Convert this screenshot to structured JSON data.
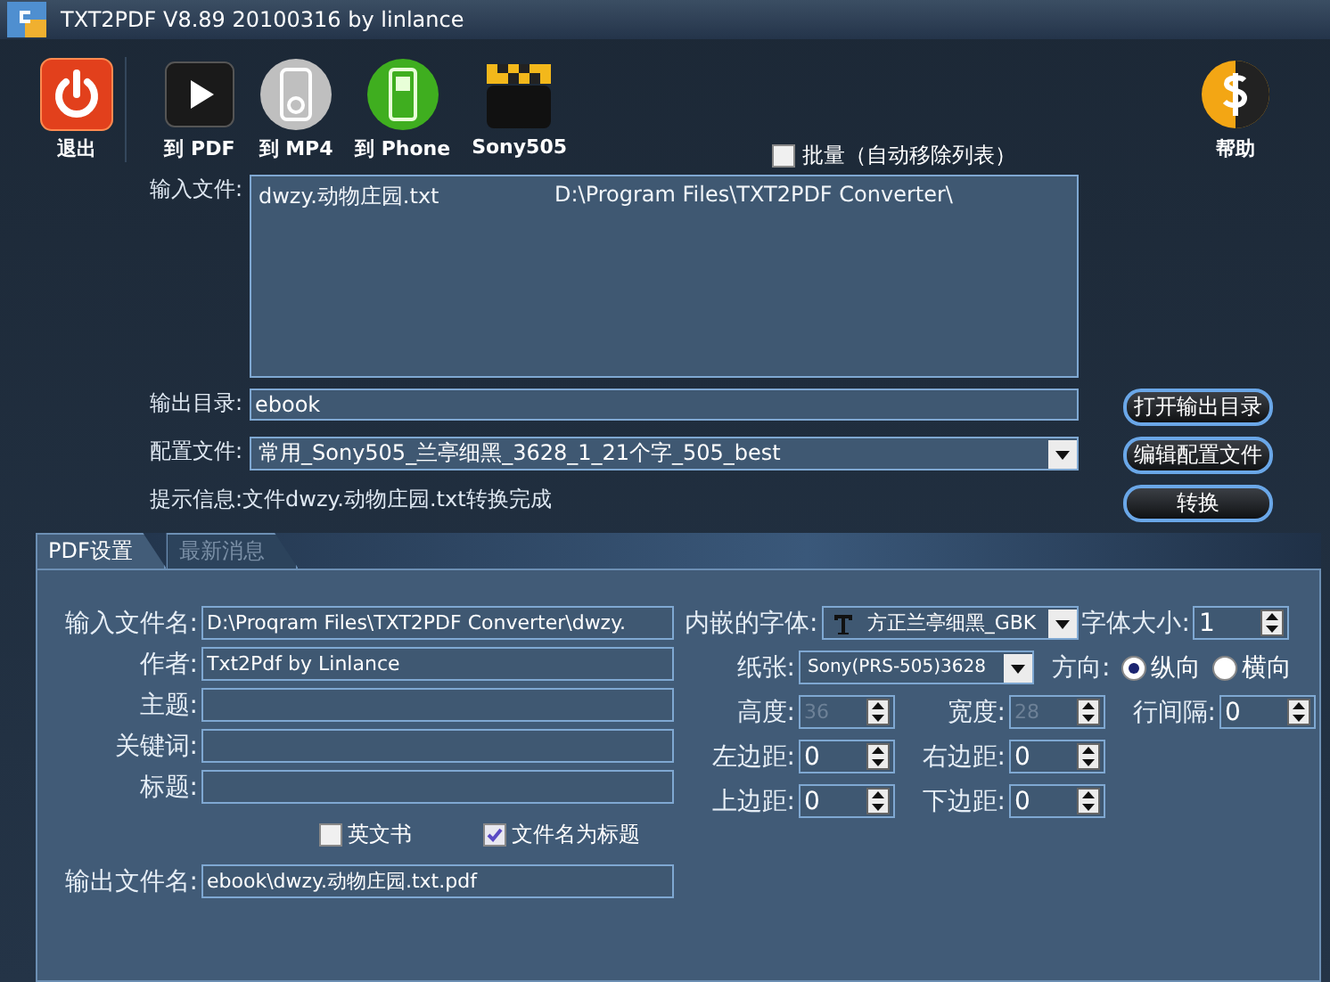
{
  "window": {
    "title": "TXT2PDF V8.89 20100316 by linlance"
  },
  "toolbar": [
    {
      "label": "退出",
      "kind": "power"
    },
    {
      "label": "到 PDF",
      "kind": "film"
    },
    {
      "label": "到 MP4",
      "kind": "player"
    },
    {
      "label": "到 Phone",
      "kind": "phone"
    },
    {
      "label": "Sony505",
      "kind": "clapper"
    }
  ],
  "batch": {
    "label": "批量（自动移除列表）",
    "checked": false
  },
  "help_button": {
    "label": "帮助"
  },
  "input_files": {
    "label": "输入文件:",
    "rows": [
      {
        "name": "dwzy.动物庄园.txt",
        "path": "D:\\Program Files\\TXT2PDF Converter\\"
      }
    ]
  },
  "output_dir": {
    "label": "输出目录:",
    "value": "ebook"
  },
  "config": {
    "label": "配置文件:",
    "value": "常用_Sony505_兰亭细黑_3628_1_21个字_505_best"
  },
  "hint": "提示信息:文件dwzy.动物庄园.txt转换完成",
  "buttons": {
    "open_output": "打开输出目录",
    "edit_config": "编辑配置文件",
    "convert": "转换"
  },
  "tabs": [
    {
      "label": "PDF设置",
      "selected": true
    },
    {
      "label": "最新消息",
      "selected": false
    }
  ],
  "pdf_fields": [
    {
      "label": "输入文件名:",
      "value": "D:\\Proqram Files\\TXT2PDF Converter\\dwzy."
    },
    {
      "label": "作者:",
      "value": "Txt2Pdf by Linlance"
    },
    {
      "label": "主题:"
    },
    {
      "label": "关键词:"
    },
    {
      "label": "标题:"
    }
  ],
  "options": [
    {
      "label": "英文书",
      "checked": false
    },
    {
      "label": "文件名为标题",
      "checked": true
    }
  ],
  "output_filename": {
    "label": "输出文件名:",
    "value": "ebook\\dwzy.动物庄园.txt.pdf"
  },
  "font": {
    "label": "内嵌的字体:",
    "value": "方正兰亭细黑_GBK"
  },
  "font_size": {
    "label": "字体大小:",
    "value": "1"
  },
  "paper": {
    "label": "纸张:",
    "value": "Sony(PRS-505)3628"
  },
  "orientation": {
    "label": "方向:",
    "options": [
      {
        "label": "纵向",
        "selected": true
      },
      {
        "label": "横向",
        "selected": false
      }
    ]
  },
  "spin_rows": [
    [
      {
        "label": "高度:",
        "value": "36",
        "disabled": true
      },
      {
        "label": "宽度:",
        "value": "28",
        "disabled": true
      },
      {
        "label": "行间隔:",
        "value": "0",
        "disabled": false
      }
    ],
    [
      {
        "label": "左边距:",
        "value": "0",
        "disabled": false
      },
      {
        "label": "右边距:",
        "value": "0",
        "disabled": false
      }
    ],
    [
      {
        "label": "上边距:",
        "value": "0",
        "disabled": false
      },
      {
        "label": "下边距:",
        "value": "0",
        "disabled": false
      }
    ]
  ]
}
